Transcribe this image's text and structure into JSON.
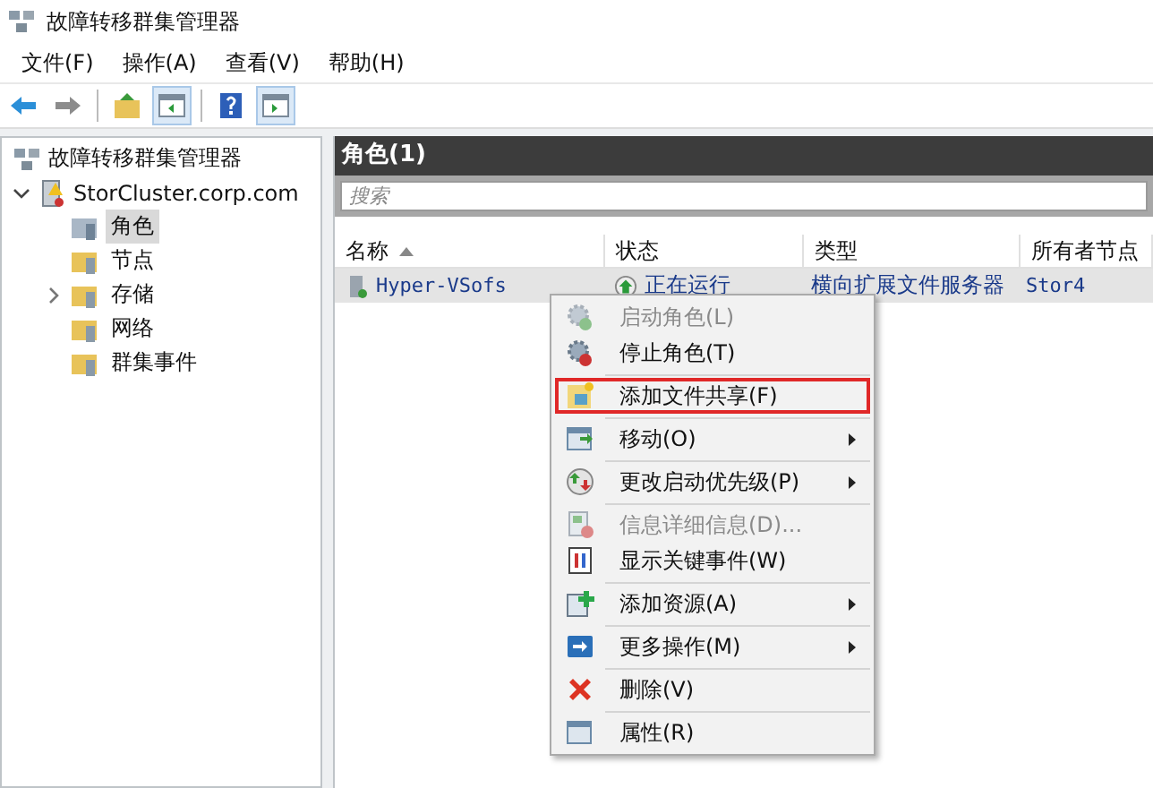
{
  "window": {
    "title": "故障转移群集管理器"
  },
  "menu_bar": [
    "文件(F)",
    "操作(A)",
    "查看(V)",
    "帮助(H)"
  ],
  "toolbar": [
    {
      "kind": "back",
      "disabled": false
    },
    {
      "kind": "forward",
      "disabled": true
    },
    {
      "kind": "up",
      "disabled": false
    },
    {
      "kind": "pane",
      "disabled": false
    },
    {
      "kind": "help",
      "disabled": false
    },
    {
      "kind": "pane2",
      "disabled": false
    }
  ],
  "tree": {
    "label": "故障转移群集管理器",
    "children": [
      {
        "label": "StorCluster.corp.com",
        "expanded": true,
        "children": [
          {
            "label": "角色",
            "selected": true,
            "expandable": false
          },
          {
            "label": "节点",
            "selected": false,
            "expandable": false
          },
          {
            "label": "存储",
            "selected": false,
            "expandable": true
          },
          {
            "label": "网络",
            "selected": false,
            "expandable": false
          },
          {
            "label": "群集事件",
            "selected": false,
            "expandable": false
          }
        ]
      }
    ]
  },
  "panel": {
    "title": "角色(1)",
    "search": {
      "placeholder": "搜索"
    },
    "table": {
      "columns": [
        {
          "label": "名称",
          "sorted": true
        },
        {
          "label": "状态",
          "sorted": false
        },
        {
          "label": "类型",
          "sorted": false
        },
        {
          "label": "所有者节点",
          "sorted": false
        }
      ],
      "rows": [
        {
          "cells": [
            "Hyper-VSofs",
            "正在运行",
            "横向扩展文件服务器",
            "Stor4"
          ],
          "selected": true
        }
      ]
    }
  },
  "context_menu": [
    {
      "kind": "item",
      "label": "启动角色(L)",
      "disabled": true,
      "submenu": false,
      "highlighted": false
    },
    {
      "kind": "item",
      "label": "停止角色(T)",
      "disabled": false,
      "submenu": false,
      "highlighted": false
    },
    {
      "kind": "separator"
    },
    {
      "kind": "item",
      "label": "添加文件共享(F)",
      "disabled": false,
      "submenu": false,
      "highlighted": true
    },
    {
      "kind": "separator"
    },
    {
      "kind": "item",
      "label": "移动(O)",
      "disabled": false,
      "submenu": true,
      "highlighted": false
    },
    {
      "kind": "separator"
    },
    {
      "kind": "item",
      "label": "更改启动优先级(P)",
      "disabled": false,
      "submenu": true,
      "highlighted": false
    },
    {
      "kind": "separator"
    },
    {
      "kind": "item",
      "label": "信息详细信息(D)...",
      "disabled": true,
      "submenu": false,
      "highlighted": false
    },
    {
      "kind": "item",
      "label": "显示关键事件(W)",
      "disabled": false,
      "submenu": false,
      "highlighted": false
    },
    {
      "kind": "separator"
    },
    {
      "kind": "item",
      "label": "添加资源(A)",
      "disabled": false,
      "submenu": true,
      "highlighted": false
    },
    {
      "kind": "separator"
    },
    {
      "kind": "item",
      "label": "更多操作(M)",
      "disabled": false,
      "submenu": true,
      "highlighted": false
    },
    {
      "kind": "separator"
    },
    {
      "kind": "item",
      "label": "删除(V)",
      "disabled": false,
      "submenu": false,
      "highlighted": false
    },
    {
      "kind": "separator"
    },
    {
      "kind": "item",
      "label": "属性(R)",
      "disabled": false,
      "submenu": false,
      "highlighted": false
    }
  ]
}
